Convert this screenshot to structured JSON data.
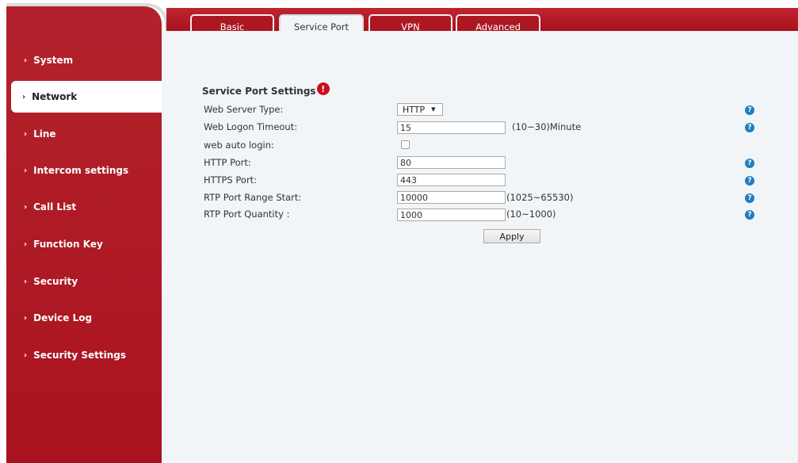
{
  "colors": {
    "brand_red": "#ad1722",
    "content_bg": "#f1f5f8",
    "help_blue": "#1e7ec0"
  },
  "sidebar": {
    "items": [
      {
        "label": "System",
        "active": false
      },
      {
        "label": "Network",
        "active": true
      },
      {
        "label": "Line",
        "active": false
      },
      {
        "label": "Intercom settings",
        "active": false
      },
      {
        "label": "Call List",
        "active": false
      },
      {
        "label": "Function Key",
        "active": false
      },
      {
        "label": "Security",
        "active": false
      },
      {
        "label": "Device Log",
        "active": false
      },
      {
        "label": "Security Settings",
        "active": false
      }
    ]
  },
  "tabs": [
    {
      "label": "Basic",
      "active": false
    },
    {
      "label": "Service Port",
      "active": true
    },
    {
      "label": "VPN",
      "active": false
    },
    {
      "label": "Advanced",
      "active": false
    }
  ],
  "section": {
    "title": "Service Port Settings",
    "warning_glyph": "!"
  },
  "form": {
    "web_server_type": {
      "label": "Web Server Type:",
      "value": "HTTP",
      "arrow": "▼"
    },
    "web_logon_timeout": {
      "label": "Web Logon Timeout:",
      "value": "15",
      "hint": "(10~30)Minute"
    },
    "web_auto_login": {
      "label": "web auto login:",
      "checked": false
    },
    "http_port": {
      "label": "HTTP Port:",
      "value": "80"
    },
    "https_port": {
      "label": "HTTPS Port:",
      "value": "443"
    },
    "rtp_port_range_start": {
      "label": "RTP Port Range Start:",
      "value": "10000",
      "hint": "(1025~65530)"
    },
    "rtp_port_quantity": {
      "label": "RTP Port Quantity :",
      "value": "1000",
      "hint": "(10~1000)"
    }
  },
  "help_glyph": "?",
  "nav_chevron": "›",
  "apply_label": "Apply"
}
